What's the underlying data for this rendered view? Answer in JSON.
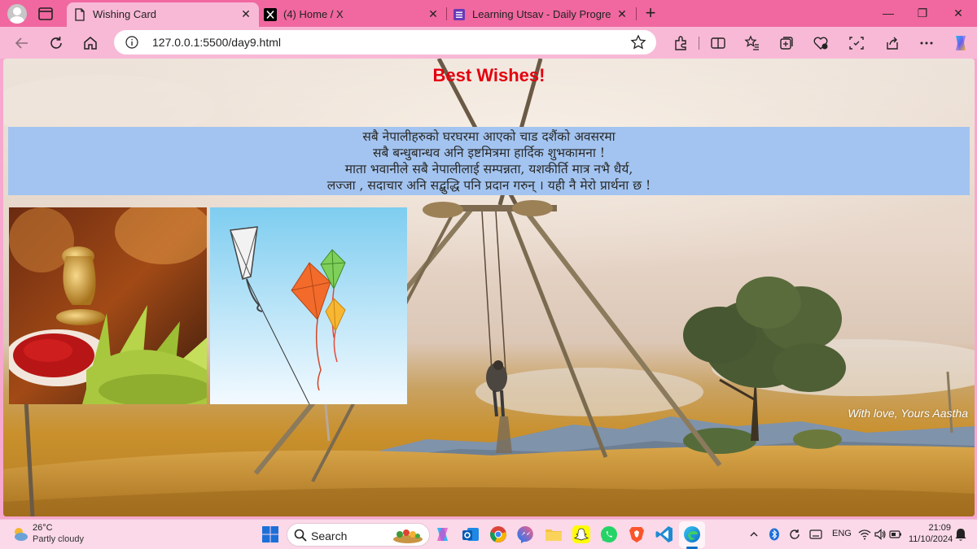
{
  "browser": {
    "tabs": [
      {
        "title": "Wishing Card",
        "active": true
      },
      {
        "title": "(4) Home / X",
        "active": false
      },
      {
        "title": "Learning Utsav - Daily Progress Tr",
        "active": false
      }
    ],
    "close_glyph": "✕",
    "new_tab_glyph": "+",
    "window_controls": {
      "minimize": "—",
      "restore": "❐",
      "close": "✕"
    },
    "address_bar": {
      "url": "127.0.0.1:5500/day9.html"
    },
    "colors": {
      "titlebar": "#f0689f",
      "toolbar": "#f8b9d6"
    }
  },
  "page": {
    "title": "Best Wishes!",
    "title_color": "#e3000f",
    "message_bg": "#a3c4f0",
    "message_lines": [
      "सबै नेपालीहरुको घरघरमा आएको चाड दशैंको अवसरमा",
      "सबै बन्धुबान्धव अनि इष्टमित्रमा हार्दिक शुभकामना !",
      "माता भवानीले सबै नेपालीलाई सम्पन्नता, यशकीर्ति मात्र नभै धैर्य,",
      "लज्जा , सदाचार अनि सद्बुद्धि पनि प्रदान गरुन् । यही नै मेरो प्रार्थना छ !"
    ],
    "signature": "With love, Yours Aastha",
    "images": [
      "tika-jamara-photo",
      "kites-illustration"
    ]
  },
  "taskbar": {
    "weather": {
      "temp": "26°C",
      "condition": "Partly cloudy"
    },
    "search_label": "Search",
    "language": "ENG",
    "time": "21:09",
    "date": "11/10/2024",
    "pinned_apps": [
      "start",
      "search",
      "copilot",
      "outlook",
      "chrome",
      "messenger",
      "file-explorer",
      "snapchat",
      "whatsapp",
      "brave",
      "vscode",
      "edge"
    ]
  }
}
